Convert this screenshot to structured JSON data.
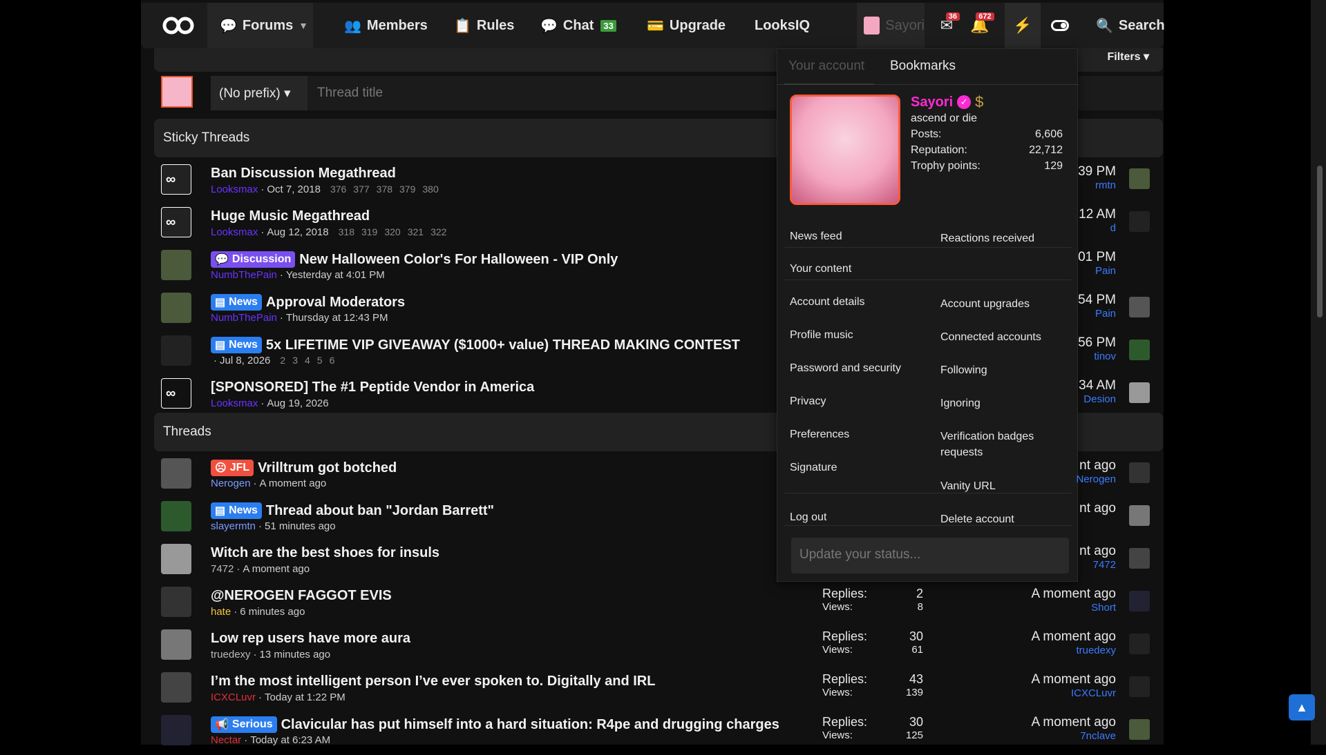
{
  "nav": {
    "forums": "Forums",
    "members": "Members",
    "rules": "Rules",
    "chat": "Chat",
    "chat_badge": "33",
    "upgrade": "Upgrade",
    "looksiq": "LooksIQ",
    "user": "Sayori",
    "inbox_badge": "36",
    "alerts_badge": "672",
    "search": "Search"
  },
  "filters": "Filters",
  "composer": {
    "prefix": "(No prefix)",
    "placeholder": "Thread title"
  },
  "sticky_header": "Sticky Threads",
  "threads_header": "Threads",
  "sticky": [
    {
      "title": "Ban Discussion Megathread",
      "author": "Looksmax",
      "date": "Oct 7, 2018",
      "pages": [
        "376",
        "377",
        "378",
        "379",
        "380"
      ],
      "last_time": "39 PM",
      "last_user": "rmtn"
    },
    {
      "title": "Huge Music Megathread",
      "author": "Looksmax",
      "date": "Aug 12, 2018",
      "pages": [
        "318",
        "319",
        "320",
        "321",
        "322"
      ],
      "last_time": "12 AM",
      "last_user": "d"
    },
    {
      "prefix": "Discussion",
      "title": "New Halloween Color's For Halloween - VIP Only",
      "author": "NumbThePain",
      "date": "Yesterday at 4:01 PM",
      "last_time": "01 PM",
      "last_user": "Pain"
    },
    {
      "prefix": "News",
      "title": "Approval Moderators",
      "author": "NumbThePain",
      "date": "Thursday at 12:43 PM",
      "last_time": "54 PM",
      "last_user": "Pain"
    },
    {
      "prefix": "News",
      "title": "5x LIFETIME VIP GIVEAWAY ($1000+ value) THREAD MAKING CONTEST",
      "author": "",
      "date": "Jul 8, 2026",
      "pages": [
        "2",
        "3",
        "4",
        "5",
        "6"
      ],
      "last_time": "56 PM",
      "last_user": "tinov"
    },
    {
      "title": "[SPONSORED] The #1 Peptide Vendor in America",
      "author": "Looksmax",
      "date": "Aug 19, 2026",
      "last_time": "34 AM",
      "last_user": "Desion"
    }
  ],
  "threads": [
    {
      "prefix": "JFL",
      "title": "Vrilltrum got botched",
      "author": "Nerogen",
      "date": "A moment ago",
      "last_time": "nt ago",
      "last_user": "Nerogen"
    },
    {
      "prefix": "News",
      "title": "Thread about ban \"Jordan Barrett\"",
      "author": "slayermtn",
      "date": "51 minutes ago",
      "last_time": "nt ago",
      "last_user": ""
    },
    {
      "title": "Witch are the best shoes for insuls",
      "author": "7472",
      "date": "A moment ago",
      "last_time": "nt ago",
      "last_user": "7472"
    },
    {
      "title": "@NEROGEN FAGGOT EVIS",
      "author": "hate",
      "date": "6 minutes ago",
      "replies_label": "Replies:",
      "replies": "2",
      "views_label": "Views:",
      "views": "8",
      "last_time": "A moment ago",
      "last_user": "Short"
    },
    {
      "title": "Low rep users have more aura",
      "author": "truedexy",
      "date": "13 minutes ago",
      "replies_label": "Replies:",
      "replies": "30",
      "views_label": "Views:",
      "views": "61",
      "last_time": "A moment ago",
      "last_user": "truedexy"
    },
    {
      "title": "I’m the most intelligent person I’ve ever spoken to. Digitally and IRL",
      "author": "ICXCLuvr",
      "date": "Today at 1:22 PM",
      "replies_label": "Replies:",
      "replies": "43",
      "views_label": "Views:",
      "views": "139",
      "last_time": "A moment ago",
      "last_user": "ICXCLuvr"
    },
    {
      "prefix": "Serious",
      "title": "Clavicular has put himself into a hard situation: R4pe and drugging charges",
      "author": "Nectar",
      "date": "Today at 6:23 AM",
      "replies_label": "Replies:",
      "replies": "30",
      "views_label": "Views:",
      "views": "125",
      "last_time": "A moment ago",
      "last_user": "7nclave"
    }
  ],
  "account": {
    "tab_account": "Your account",
    "tab_bookmarks": "Bookmarks",
    "name": "Sayori",
    "user_title": "ascend or die",
    "posts_label": "Posts:",
    "posts": "6,606",
    "rep_label": "Reputation:",
    "rep": "22,712",
    "trophy_label": "Trophy points:",
    "trophy": "129",
    "links_left": [
      "News feed",
      "Your content",
      "Account details",
      "Profile music",
      "Password and security",
      "Privacy",
      "Preferences",
      "Signature",
      "Log out"
    ],
    "links_right": [
      "Reactions received",
      "Account upgrades",
      "Connected accounts",
      "Following",
      "Ignoring",
      "Verification badges requests",
      "Vanity URL",
      "Delete account"
    ],
    "status_placeholder": "Update your status..."
  },
  "colors": {
    "accent": "#2b7ef0",
    "author": "#6a33ff",
    "name": "#ff2ad4"
  }
}
